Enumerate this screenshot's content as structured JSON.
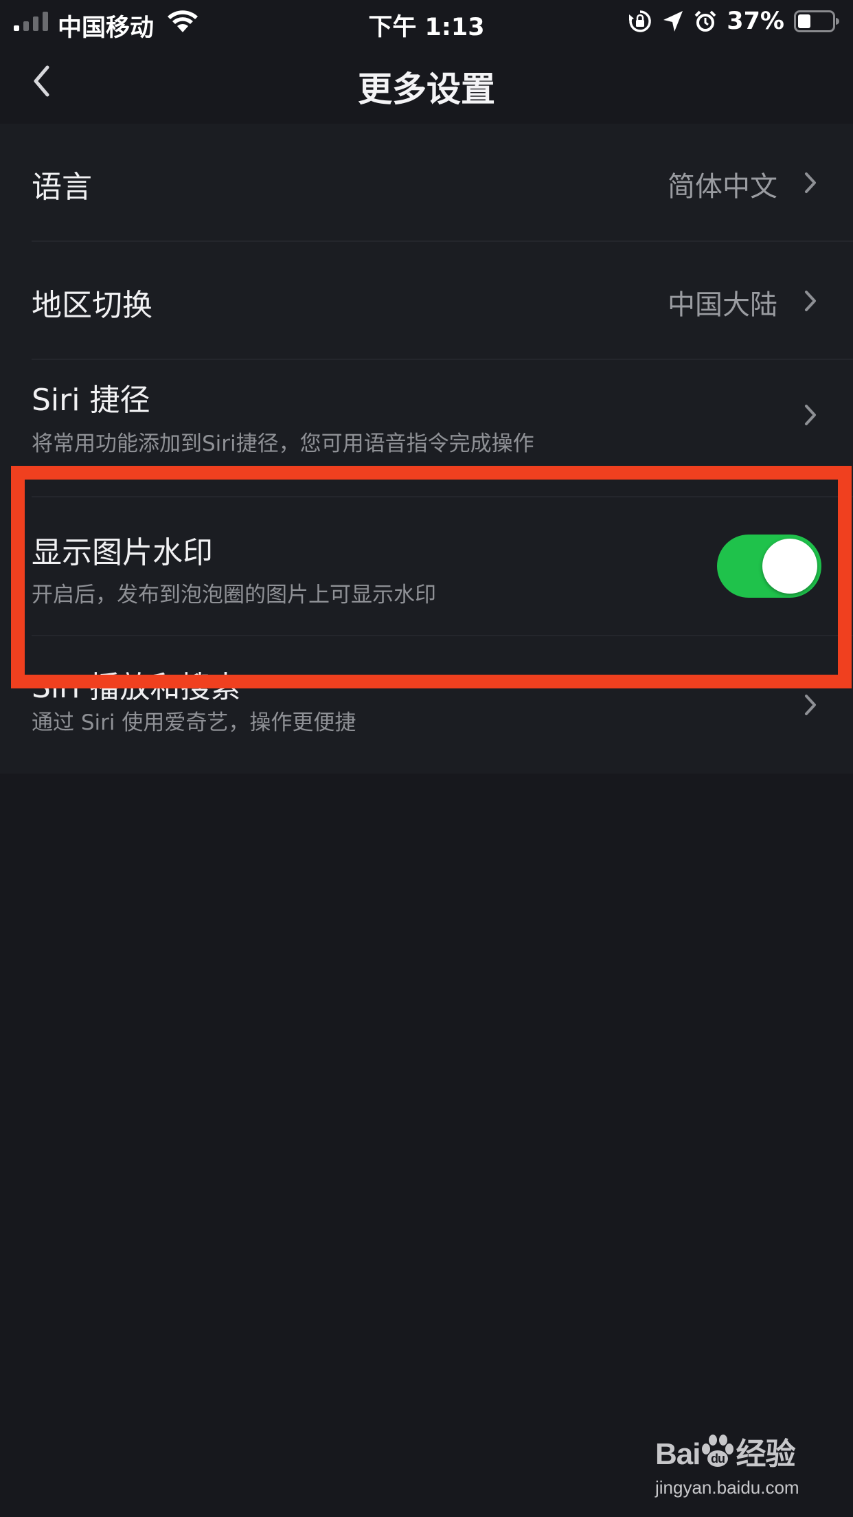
{
  "status_bar": {
    "carrier": "中国移动",
    "time": "下午 1:13",
    "battery": "37%",
    "battery_level": 0.37,
    "icons": [
      "signal-icon",
      "wifi-icon",
      "orientation-lock-icon",
      "location-icon",
      "alarm-icon",
      "battery-icon"
    ]
  },
  "nav": {
    "title": "更多设置",
    "back_icon": "chevron-left-icon"
  },
  "settings": {
    "language": {
      "label": "语言",
      "value": "简体中文"
    },
    "region": {
      "label": "地区切换",
      "value": "中国大陆"
    },
    "siri_shortcuts": {
      "label": "Siri 捷径",
      "description": "将常用功能添加到Siri捷径，您可用语音指令完成操作"
    },
    "watermark": {
      "label": "显示图片水印",
      "description": "开启后，发布到泡泡圈的图片上可显示水印",
      "enabled": true
    },
    "siri_play": {
      "label": "Siri 播放和搜索",
      "description": "通过 Siri 使用爱奇艺，操作更便捷"
    }
  },
  "colors": {
    "background": "#17181d",
    "list_background": "#1b1d22",
    "toggle_on": "#1fc24b",
    "highlight": "#f0401f"
  },
  "watermark_logo": {
    "brand_left": "Bai",
    "brand_right": "经验",
    "site": "jingyan.baidu.com"
  }
}
